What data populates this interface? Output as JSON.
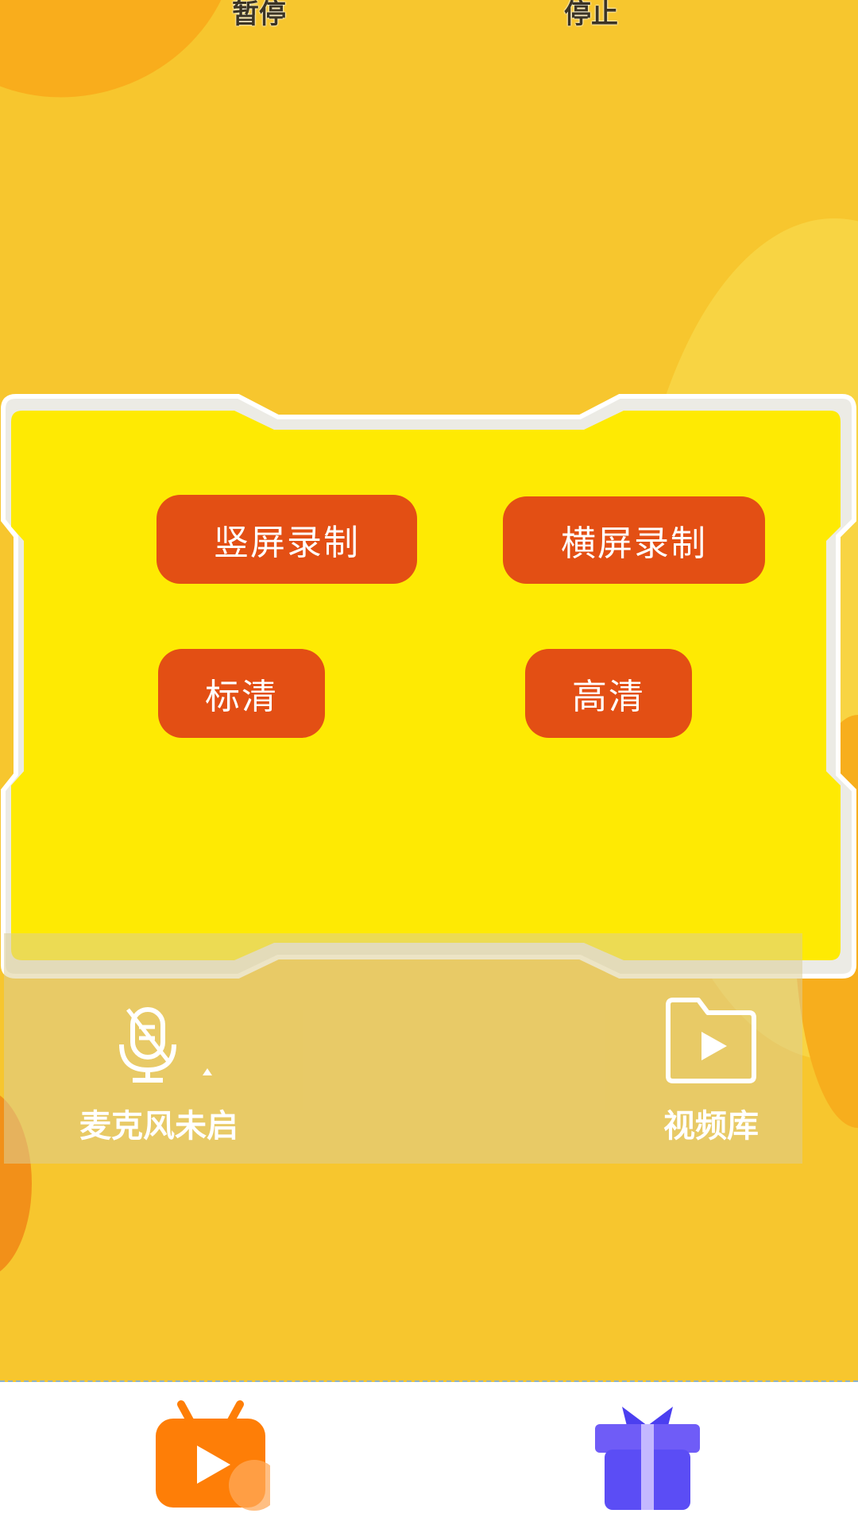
{
  "controls": {
    "pause_label": "暂停",
    "stop_label": "停止"
  },
  "recording": {
    "portrait_label": "竖屏录制",
    "landscape_label": "横屏录制",
    "sd_label": "标清",
    "hd_label": "高清"
  },
  "tools": {
    "mic_label": "麦克风未启",
    "video_library_label": "视频库"
  },
  "colors": {
    "background": "#f7c62e",
    "panel": "#feea03",
    "button": "#e34f14",
    "tv_icon": "#fe7e07",
    "gift_icon": "#5b4df5"
  },
  "nav": {
    "items": [
      {
        "icon": "tv-play-icon"
      },
      {
        "icon": "gift-icon"
      }
    ]
  }
}
